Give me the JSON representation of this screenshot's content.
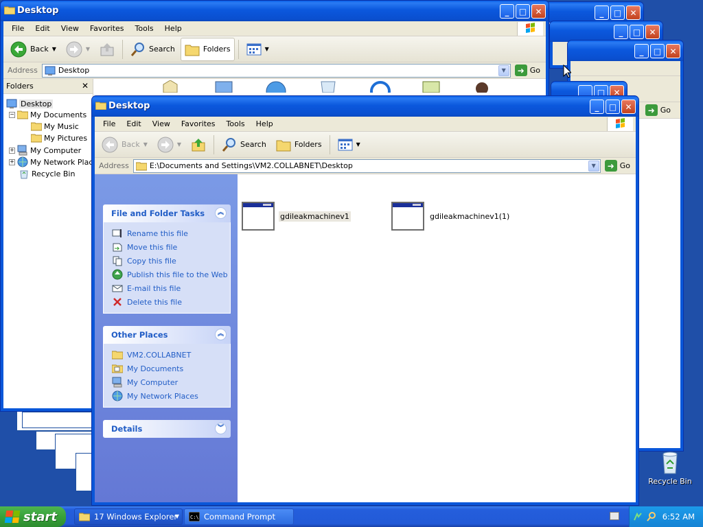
{
  "colors": {
    "desktop": "#1f4fa8",
    "title_bar": "#0a58dd",
    "task_panel": "#6f8bdd",
    "task_link": "#215dc6",
    "start_button": "#38a13a"
  },
  "back_window": {
    "title": "Desktop",
    "menu": [
      "File",
      "Edit",
      "View",
      "Favorites",
      "Tools",
      "Help"
    ],
    "toolbar": {
      "back": "Back",
      "search": "Search",
      "folders": "Folders"
    },
    "address_label": "Address",
    "address_value": "Desktop",
    "go_label": "Go",
    "folders_pane": {
      "title": "Folders",
      "items": [
        {
          "label": "Desktop",
          "icon": "desktop-icon",
          "level": 0,
          "expander": ""
        },
        {
          "label": "My Documents",
          "icon": "folder-icon",
          "level": 1,
          "expander": "−"
        },
        {
          "label": "My Music",
          "icon": "folder-icon",
          "level": 2,
          "expander": ""
        },
        {
          "label": "My Pictures",
          "icon": "folder-icon",
          "level": 2,
          "expander": ""
        },
        {
          "label": "My Computer",
          "icon": "computer-icon",
          "level": 1,
          "expander": "+"
        },
        {
          "label": "My Network Places",
          "icon": "network-icon",
          "level": 1,
          "expander": "+"
        },
        {
          "label": "Recycle Bin",
          "icon": "recycle-bin-icon",
          "level": 1,
          "expander": ""
        }
      ]
    }
  },
  "behind_windows": {
    "go_label_1": "Go",
    "go_label_2": "Go"
  },
  "front_window": {
    "title": "Desktop",
    "menu": [
      "File",
      "Edit",
      "View",
      "Favorites",
      "Tools",
      "Help"
    ],
    "toolbar": {
      "back": "Back",
      "search": "Search",
      "folders": "Folders"
    },
    "address_label": "Address",
    "address_value": "E:\\Documents and Settings\\VM2.COLLABNET\\Desktop",
    "go_label": "Go",
    "file_tasks": {
      "title": "File and Folder Tasks",
      "items": [
        {
          "label": "Rename this file",
          "icon": "rename-icon"
        },
        {
          "label": "Move this file",
          "icon": "move-icon"
        },
        {
          "label": "Copy this file",
          "icon": "copy-icon"
        },
        {
          "label": "Publish this file to the Web",
          "icon": "publish-web-icon"
        },
        {
          "label": "E-mail this file",
          "icon": "email-icon"
        },
        {
          "label": "Delete this file",
          "icon": "delete-icon"
        }
      ]
    },
    "other_places": {
      "title": "Other Places",
      "items": [
        {
          "label": "VM2.COLLABNET",
          "icon": "folder-icon"
        },
        {
          "label": "My Documents",
          "icon": "my-documents-icon"
        },
        {
          "label": "My Computer",
          "icon": "computer-icon"
        },
        {
          "label": "My Network Places",
          "icon": "network-icon"
        }
      ]
    },
    "details": {
      "title": "Details"
    },
    "files": [
      {
        "label": "gdileakmachinev1",
        "selected": true
      },
      {
        "label": "gdileakmachinev1(1)",
        "selected": false
      }
    ]
  },
  "desktop_icon": {
    "label": "Recycle Bin"
  },
  "taskbar": {
    "start_label": "start",
    "buttons": [
      {
        "label": "17 Windows Explorer",
        "icon": "folder-icon"
      },
      {
        "label": "Command Prompt",
        "icon": "cmd-icon"
      }
    ],
    "clock": "6:52 AM"
  }
}
